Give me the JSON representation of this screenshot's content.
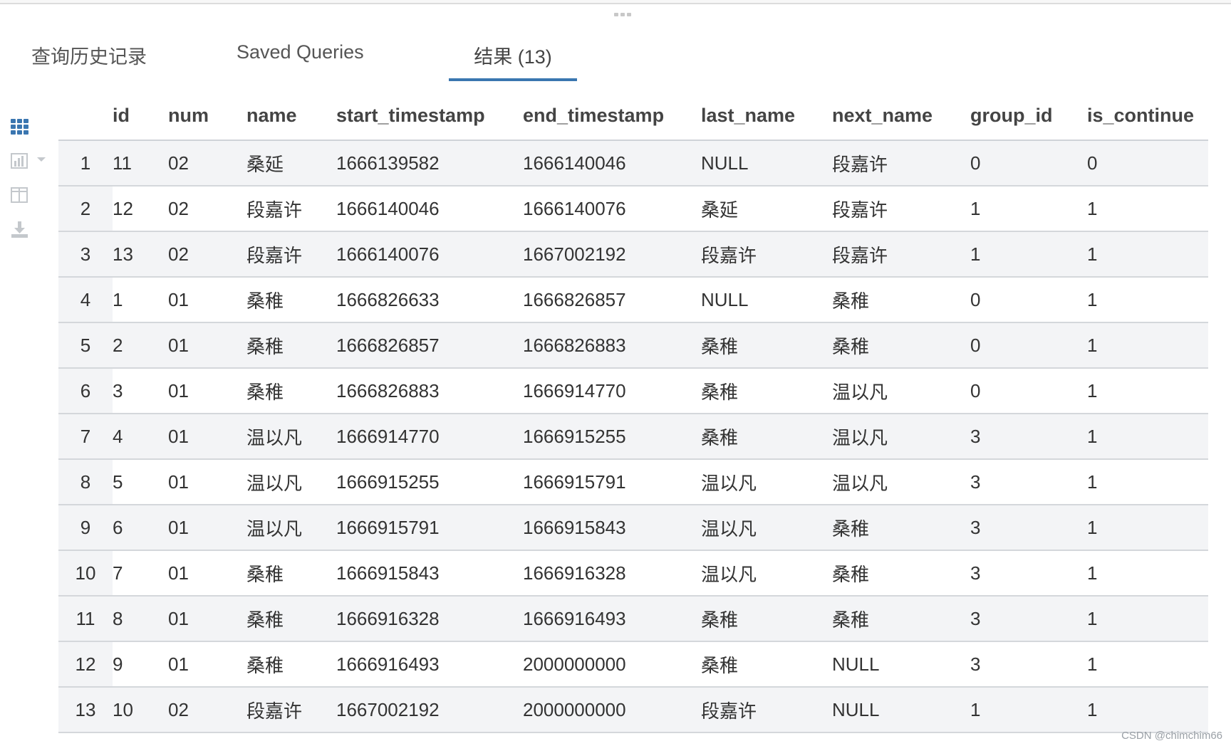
{
  "tabs": [
    {
      "label": "查询历史记录",
      "active": false
    },
    {
      "label": "Saved Queries",
      "active": false
    },
    {
      "label": "结果 (13)",
      "active": true
    }
  ],
  "columns": [
    "",
    "id",
    "num",
    "name",
    "start_timestamp",
    "end_timestamp",
    "last_name",
    "next_name",
    "group_id",
    "is_continue"
  ],
  "rows": [
    [
      "1",
      "11",
      "02",
      "桑延",
      "1666139582",
      "1666140046",
      "NULL",
      "段嘉许",
      "0",
      "0"
    ],
    [
      "2",
      "12",
      "02",
      "段嘉许",
      "1666140046",
      "1666140076",
      "桑延",
      "段嘉许",
      "1",
      "1"
    ],
    [
      "3",
      "13",
      "02",
      "段嘉许",
      "1666140076",
      "1667002192",
      "段嘉许",
      "段嘉许",
      "1",
      "1"
    ],
    [
      "4",
      "1",
      "01",
      "桑稚",
      "1666826633",
      "1666826857",
      "NULL",
      "桑稚",
      "0",
      "1"
    ],
    [
      "5",
      "2",
      "01",
      "桑稚",
      "1666826857",
      "1666826883",
      "桑稚",
      "桑稚",
      "0",
      "1"
    ],
    [
      "6",
      "3",
      "01",
      "桑稚",
      "1666826883",
      "1666914770",
      "桑稚",
      "温以凡",
      "0",
      "1"
    ],
    [
      "7",
      "4",
      "01",
      "温以凡",
      "1666914770",
      "1666915255",
      "桑稚",
      "温以凡",
      "3",
      "1"
    ],
    [
      "8",
      "5",
      "01",
      "温以凡",
      "1666915255",
      "1666915791",
      "温以凡",
      "温以凡",
      "3",
      "1"
    ],
    [
      "9",
      "6",
      "01",
      "温以凡",
      "1666915791",
      "1666915843",
      "温以凡",
      "桑稚",
      "3",
      "1"
    ],
    [
      "10",
      "7",
      "01",
      "桑稚",
      "1666915843",
      "1666916328",
      "温以凡",
      "桑稚",
      "3",
      "1"
    ],
    [
      "11",
      "8",
      "01",
      "桑稚",
      "1666916328",
      "1666916493",
      "桑稚",
      "桑稚",
      "3",
      "1"
    ],
    [
      "12",
      "9",
      "01",
      "桑稚",
      "1666916493",
      "2000000000",
      "桑稚",
      "NULL",
      "3",
      "1"
    ],
    [
      "13",
      "10",
      "02",
      "段嘉许",
      "1667002192",
      "2000000000",
      "段嘉许",
      "NULL",
      "1",
      "1"
    ]
  ],
  "rail_icons": [
    {
      "name": "grid-view-icon",
      "active": true
    },
    {
      "name": "chart-icon",
      "active": false
    },
    {
      "name": "columns-icon",
      "active": false
    },
    {
      "name": "download-icon",
      "active": false
    }
  ],
  "colors": {
    "accent": "#3a76b0",
    "row_alt": "#f3f4f6",
    "icon_inactive": "#c4c8cc"
  },
  "watermark": "CSDN @chimchim66"
}
